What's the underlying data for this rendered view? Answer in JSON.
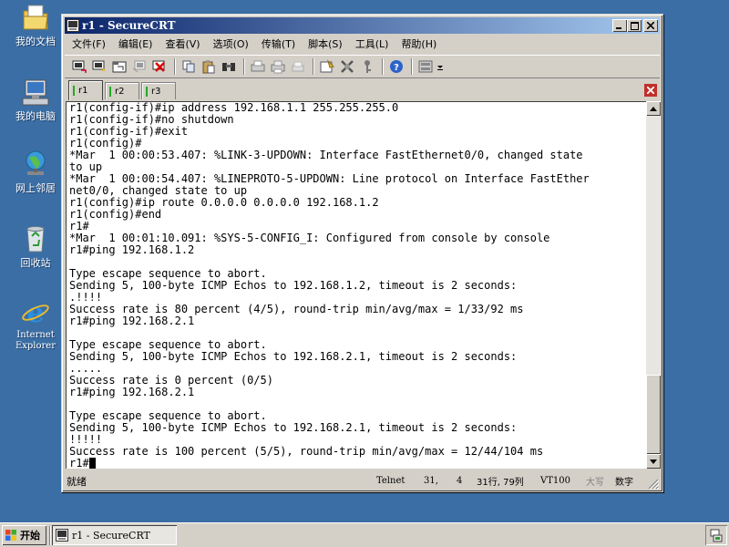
{
  "desktop": {
    "icons": [
      {
        "label": "我的文档",
        "icon": "my-documents-icon"
      },
      {
        "label": "我的电脑",
        "icon": "my-computer-icon"
      },
      {
        "label": "网上邻居",
        "icon": "network-places-icon"
      },
      {
        "label": "回收站",
        "icon": "recycle-bin-icon"
      },
      {
        "label": "Internet Explorer",
        "icon": "internet-explorer-icon"
      }
    ]
  },
  "window": {
    "title": "r1 - SecureCRT",
    "controls": {
      "minimize": "_",
      "maximize": "□",
      "close": "×"
    },
    "menu": [
      "文件(F)",
      "编辑(E)",
      "查看(V)",
      "选项(O)",
      "传输(T)",
      "脚本(S)",
      "工具(L)",
      "帮助(H)"
    ],
    "toolbar_icons": [
      "connect-icon",
      "quick-connect-icon",
      "connect-in-tab-icon",
      "reconnect-icon",
      "disconnect-icon",
      "copy-icon",
      "paste-icon",
      "find-icon",
      "print-icon",
      "print-setup-icon",
      "print-selection-icon",
      "session-options-icon",
      "global-options-icon",
      "keymap-icon",
      "help-icon",
      "sftp-icon"
    ],
    "tabs": [
      {
        "label": "r1",
        "active": true
      },
      {
        "label": "r2",
        "active": false
      },
      {
        "label": "r3",
        "active": false
      }
    ],
    "terminal_lines": [
      "r1(config-if)#ip address 192.168.1.1 255.255.255.0",
      "r1(config-if)#no shutdown",
      "r1(config-if)#exit",
      "r1(config)#",
      "*Mar  1 00:00:53.407: %LINK-3-UPDOWN: Interface FastEthernet0/0, changed state",
      "to up",
      "*Mar  1 00:00:54.407: %LINEPROTO-5-UPDOWN: Line protocol on Interface FastEther",
      "net0/0, changed state to up",
      "r1(config)#ip route 0.0.0.0 0.0.0.0 192.168.1.2",
      "r1(config)#end",
      "r1#",
      "*Mar  1 00:01:10.091: %SYS-5-CONFIG_I: Configured from console by console",
      "r1#ping 192.168.1.2",
      "",
      "Type escape sequence to abort.",
      "Sending 5, 100-byte ICMP Echos to 192.168.1.2, timeout is 2 seconds:",
      ".!!!!",
      "Success rate is 80 percent (4/5), round-trip min/avg/max = 1/33/92 ms",
      "r1#ping 192.168.2.1",
      "",
      "Type escape sequence to abort.",
      "Sending 5, 100-byte ICMP Echos to 192.168.2.1, timeout is 2 seconds:",
      ".....",
      "Success rate is 0 percent (0/5)",
      "r1#ping 192.168.2.1",
      "",
      "Type escape sequence to abort.",
      "Sending 5, 100-byte ICMP Echos to 192.168.2.1, timeout is 2 seconds:",
      "!!!!!",
      "Success rate is 100 percent (5/5), round-trip min/avg/max = 12/44/104 ms",
      "r1#"
    ],
    "statusbar": {
      "ready": "就绪",
      "protocol": "Telnet",
      "row": "31,",
      "col": "4",
      "position": "31行, 79列",
      "emulation": "VT100",
      "caps": "大写",
      "num": "数字"
    }
  },
  "taskbar": {
    "start_label": "开始",
    "task_title": "r1 - SecureCRT"
  },
  "colors": {
    "desktop": "#3a6ea5",
    "titlebar_start": "#0a246a",
    "titlebar_end": "#a6caf0",
    "tab_indicator": "#22aa22"
  }
}
